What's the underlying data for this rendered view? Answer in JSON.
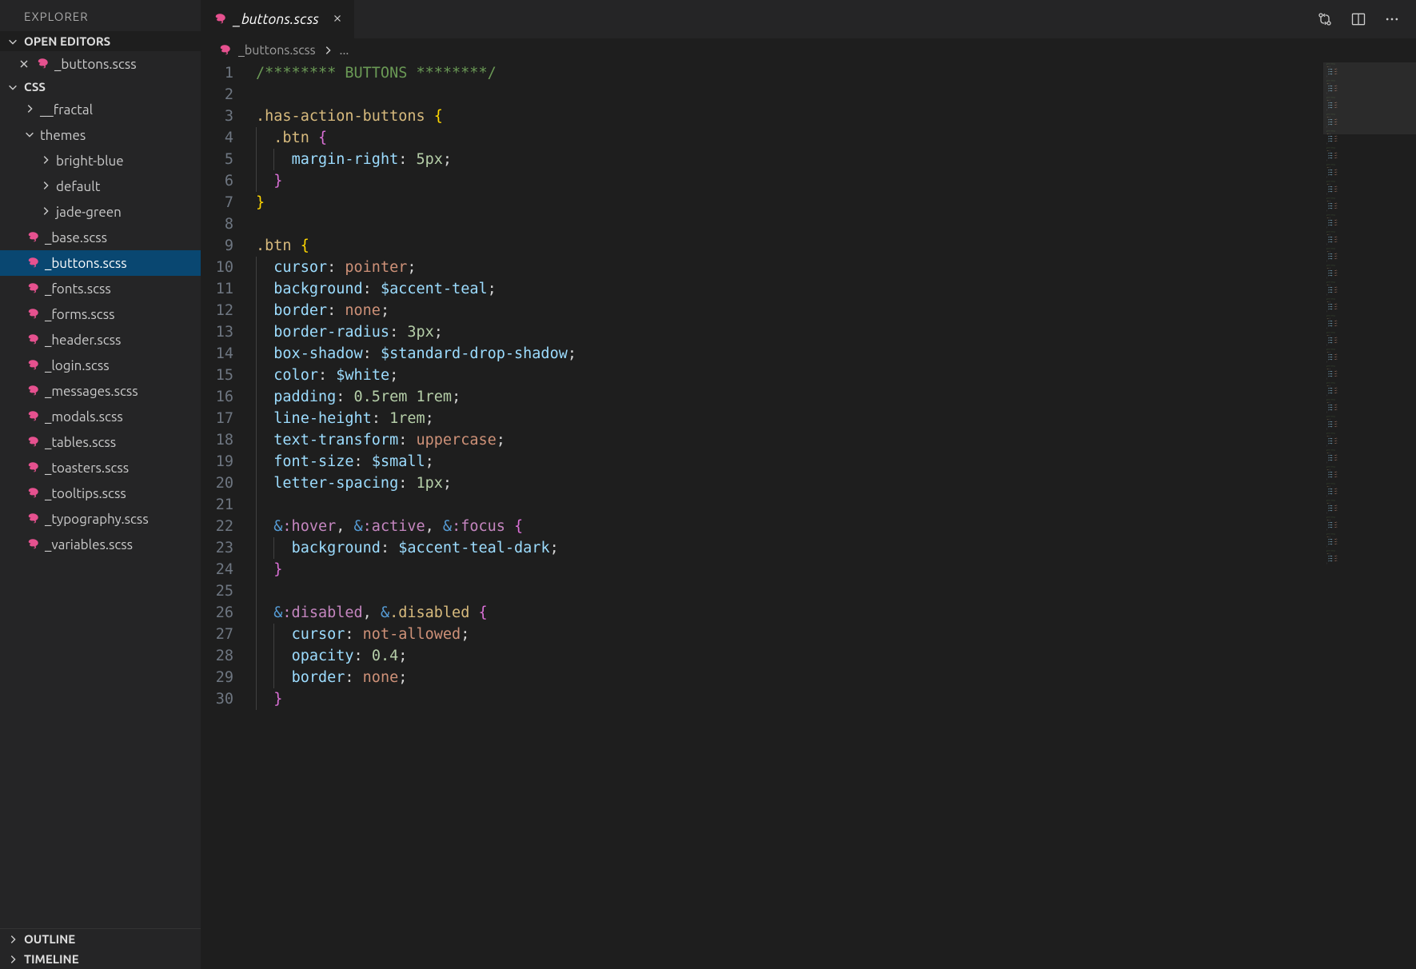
{
  "explorer": {
    "title": "EXPLORER",
    "openEditors": {
      "label": "OPEN EDITORS",
      "items": [
        {
          "name": "_buttons.scss"
        }
      ]
    },
    "project": {
      "label": "CSS",
      "folders": [
        {
          "name": "__fractal",
          "expanded": false,
          "depth": 1
        },
        {
          "name": "themes",
          "expanded": true,
          "depth": 1
        },
        {
          "name": "bright-blue",
          "expanded": false,
          "depth": 2
        },
        {
          "name": "default",
          "expanded": false,
          "depth": 2
        },
        {
          "name": "jade-green",
          "expanded": false,
          "depth": 2
        }
      ],
      "files": [
        "_base.scss",
        "_buttons.scss",
        "_fonts.scss",
        "_forms.scss",
        "_header.scss",
        "_login.scss",
        "_messages.scss",
        "_modals.scss",
        "_tables.scss",
        "_toasters.scss",
        "_tooltips.scss",
        "_typography.scss",
        "_variables.scss"
      ],
      "activeFile": "_buttons.scss"
    },
    "outline": "OUTLINE",
    "timeline": "TIMELINE"
  },
  "tab": {
    "filename": "_buttons.scss"
  },
  "breadcrumb": {
    "file": "_buttons.scss",
    "rest": "..."
  },
  "code": {
    "lines": [
      {
        "n": 1,
        "html": "<span class='cmt'>/******** BUTTONS ********/</span>"
      },
      {
        "n": 2,
        "html": ""
      },
      {
        "n": 3,
        "html": "<span class='sel'>.has-action-buttons</span> <span class='br'>{</span>"
      },
      {
        "n": 4,
        "html": "<span class='ig' style='left:0'></span>  <span class='sel'>.btn</span> <span class='br2'>{</span>"
      },
      {
        "n": 5,
        "html": "<span class='ig' style='left:0'></span><span class='ig' style='left:22px'></span>    <span class='prop'>margin-right</span><span class='w'>:</span> <span class='num'>5px</span><span class='w'>;</span>"
      },
      {
        "n": 6,
        "html": "<span class='ig' style='left:0'></span>  <span class='br2'>}</span>"
      },
      {
        "n": 7,
        "html": "<span class='br'>}</span>"
      },
      {
        "n": 8,
        "html": ""
      },
      {
        "n": 9,
        "html": "<span class='sel'>.btn</span> <span class='br'>{</span>"
      },
      {
        "n": 10,
        "html": "<span class='ig' style='left:0'></span>  <span class='prop'>cursor</span><span class='w'>:</span> <span class='val'>pointer</span><span class='w'>;</span>"
      },
      {
        "n": 11,
        "html": "<span class='ig' style='left:0'></span>  <span class='prop'>background</span><span class='w'>:</span> <span class='var'>$accent-teal</span><span class='w'>;</span>"
      },
      {
        "n": 12,
        "html": "<span class='ig' style='left:0'></span>  <span class='prop'>border</span><span class='w'>:</span> <span class='val'>none</span><span class='w'>;</span>"
      },
      {
        "n": 13,
        "html": "<span class='ig' style='left:0'></span>  <span class='prop'>border-radius</span><span class='w'>:</span> <span class='num'>3px</span><span class='w'>;</span>"
      },
      {
        "n": 14,
        "html": "<span class='ig' style='left:0'></span>  <span class='prop'>box-shadow</span><span class='w'>:</span> <span class='var'>$standard-drop-shadow</span><span class='w'>;</span>"
      },
      {
        "n": 15,
        "html": "<span class='ig' style='left:0'></span>  <span class='prop'>color</span><span class='w'>:</span> <span class='var'>$white</span><span class='w'>;</span>"
      },
      {
        "n": 16,
        "html": "<span class='ig' style='left:0'></span>  <span class='prop'>padding</span><span class='w'>:</span> <span class='num'>0.5rem</span> <span class='num'>1rem</span><span class='w'>;</span>"
      },
      {
        "n": 17,
        "html": "<span class='ig' style='left:0'></span>  <span class='prop'>line-height</span><span class='w'>:</span> <span class='num'>1rem</span><span class='w'>;</span>"
      },
      {
        "n": 18,
        "html": "<span class='ig' style='left:0'></span>  <span class='prop'>text-transform</span><span class='w'>:</span> <span class='val'>uppercase</span><span class='w'>;</span>"
      },
      {
        "n": 19,
        "html": "<span class='ig' style='left:0'></span>  <span class='prop'>font-size</span><span class='w'>:</span> <span class='var'>$small</span><span class='w'>;</span>"
      },
      {
        "n": 20,
        "html": "<span class='ig' style='left:0'></span>  <span class='prop'>letter-spacing</span><span class='w'>:</span> <span class='num'>1px</span><span class='w'>;</span>"
      },
      {
        "n": 21,
        "html": "<span class='ig' style='left:0'></span>"
      },
      {
        "n": 22,
        "html": "<span class='ig' style='left:0'></span>  <span class='amp'>&amp;</span><span class='pc'>:hover</span><span class='w'>,</span> <span class='amp'>&amp;</span><span class='pc'>:active</span><span class='w'>,</span> <span class='amp'>&amp;</span><span class='pc'>:focus</span> <span class='br2'>{</span>"
      },
      {
        "n": 23,
        "html": "<span class='ig' style='left:0'></span><span class='ig' style='left:22px'></span>    <span class='prop'>background</span><span class='w'>:</span> <span class='var'>$accent-teal-dark</span><span class='w'>;</span>"
      },
      {
        "n": 24,
        "html": "<span class='ig' style='left:0'></span>  <span class='br2'>}</span>"
      },
      {
        "n": 25,
        "html": "<span class='ig' style='left:0'></span>"
      },
      {
        "n": 26,
        "html": "<span class='ig' style='left:0'></span>  <span class='amp'>&amp;</span><span class='pc'>:disabled</span><span class='w'>,</span> <span class='amp'>&amp;</span><span class='sel'>.disabled</span> <span class='br2'>{</span>"
      },
      {
        "n": 27,
        "html": "<span class='ig' style='left:0'></span><span class='ig' style='left:22px'></span>    <span class='prop'>cursor</span><span class='w'>:</span> <span class='val'>not-allowed</span><span class='w'>;</span>"
      },
      {
        "n": 28,
        "html": "<span class='ig' style='left:0'></span><span class='ig' style='left:22px'></span>    <span class='prop'>opacity</span><span class='w'>:</span> <span class='num'>0.4</span><span class='w'>;</span>"
      },
      {
        "n": 29,
        "html": "<span class='ig' style='left:0'></span><span class='ig' style='left:22px'></span>    <span class='prop'>border</span><span class='w'>:</span> <span class='val'>none</span><span class='w'>;</span>"
      },
      {
        "n": 30,
        "html": "<span class='ig' style='left:0'></span>  <span class='br2'>}</span>"
      }
    ]
  }
}
